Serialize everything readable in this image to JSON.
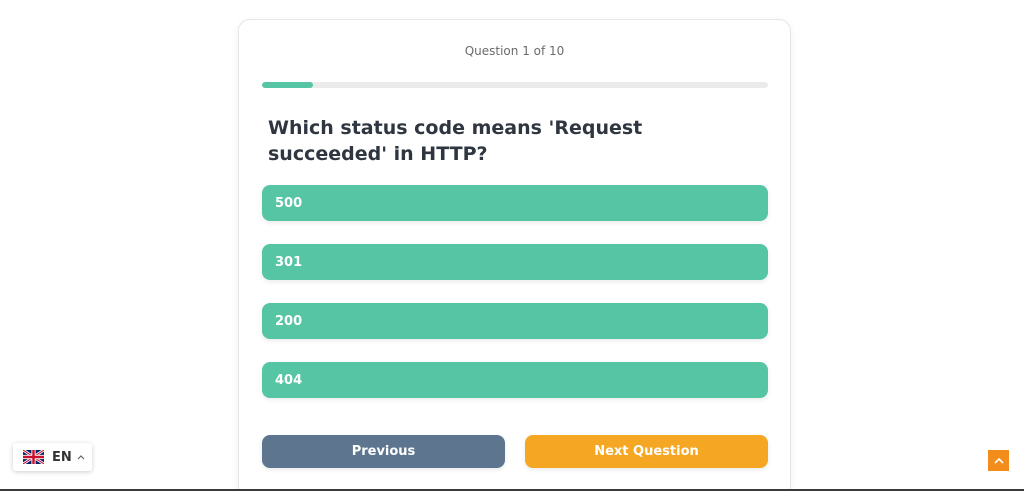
{
  "quiz": {
    "counter": "Question 1 of 10",
    "progress": 0.1,
    "question": "Which status code means 'Request succeeded' in HTTP?",
    "options": [
      "500",
      "301",
      "200",
      "404"
    ],
    "previous_label": "Previous",
    "next_label": "Next Question"
  },
  "language": {
    "code": "EN",
    "flag_icon": "uk-flag-icon",
    "caret_icon": "chevron-up-icon"
  },
  "scroll_top": {
    "icon": "chevron-up-icon"
  },
  "colors": {
    "accent": "#55c5a3",
    "option_bg": "#55c5a3",
    "previous_bg": "#5e7590",
    "next_bg": "#f5a623",
    "scroll_top_bg": "#f28c1b",
    "progress_track": "#ebebeb"
  }
}
